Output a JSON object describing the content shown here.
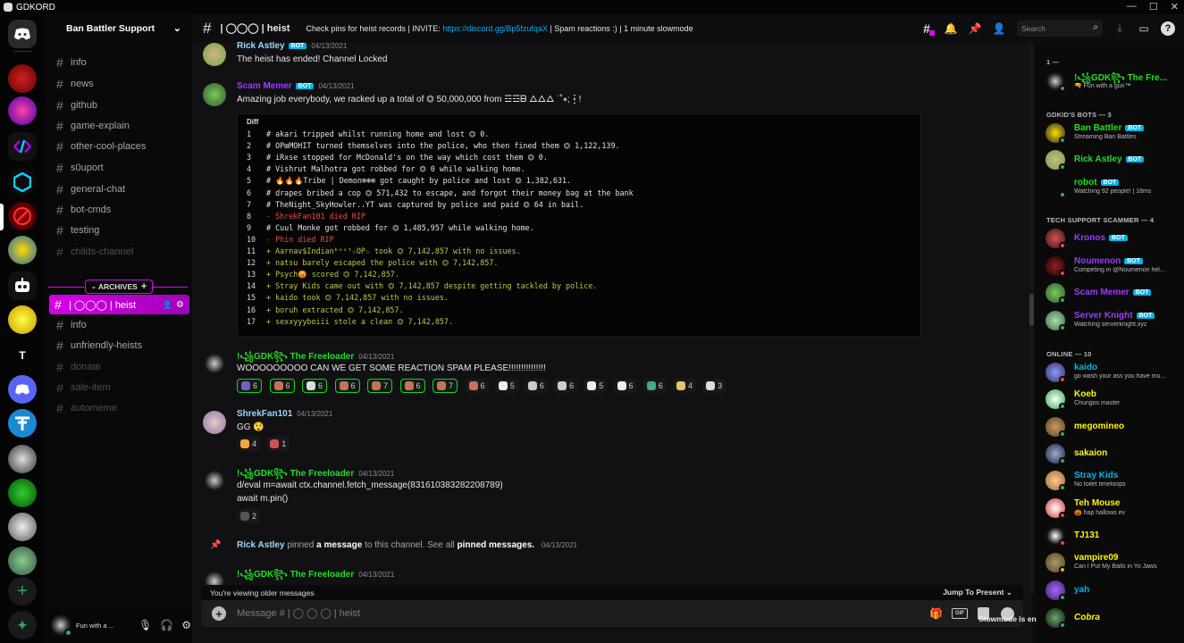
{
  "app_title": "GDKORD",
  "window_controls": [
    "—",
    "☐",
    "✕"
  ],
  "server": {
    "name": "Ban Battler Support"
  },
  "guild_letter": "T",
  "channels": [
    {
      "name": "info",
      "dim": false
    },
    {
      "name": "news",
      "dim": false
    },
    {
      "name": "github",
      "dim": false
    },
    {
      "name": "game-explain",
      "dim": false
    },
    {
      "name": "other-cool-places",
      "dim": false
    },
    {
      "name": "s0uport",
      "dim": false
    },
    {
      "name": "general-chat",
      "dim": false
    },
    {
      "name": "bot-cmds",
      "dim": false
    },
    {
      "name": "testing",
      "dim": false
    },
    {
      "name": "childs-channel",
      "dim": true
    }
  ],
  "archives_label": "ARCHIVES",
  "active_channel": "| ◯◯◯ | heist",
  "archive_channels": [
    {
      "name": "info",
      "dim": false
    },
    {
      "name": "unfriendly-heists",
      "dim": false
    },
    {
      "name": "donate",
      "dim": true
    },
    {
      "name": "sale-item",
      "dim": true
    },
    {
      "name": "automeme",
      "dim": true
    }
  ],
  "user_status": "Fun with a ...",
  "header": {
    "channel_name": "| ◯◯◯ | heist",
    "topic_prefix": "Check pins for heist records | INVITE:",
    "topic_link": "https://discord.gg/Bp5fzufqaX",
    "topic_suffix": "| Spam reactions :) | 1 minute slowmode",
    "search_placeholder": "Search"
  },
  "messages": {
    "m1": {
      "author": "Rick Astley",
      "bot_tag": "BOT",
      "ts": "04/13/2021",
      "text": "The heist has ended! Channel Locked"
    },
    "m2": {
      "author": "Scam Memer",
      "bot_tag": "BOT",
      "ts": "04/13/2021",
      "text": "Amazing job everybody, we racked up a total of ⏣ 50,000,000  from  ☲☲ᗷ ᐃᐃᐃ ˙˚∗;┇!"
    },
    "m3": {
      "author": "!꧁GDK꧂ The Freeloader",
      "ts": "04/13/2021",
      "text": "WOOOOOOOOO CAN WE GET SOME REACTION SPAM PLEASE!!!!!!!!!!!!!!!"
    },
    "m4": {
      "author": "ShrekFan101",
      "ts": "04/13/2021",
      "text": "GG 😲"
    },
    "m5": {
      "author": "!꧁GDK꧂ The Freeloader",
      "ts": "04/13/2021",
      "line1": "d/eval m=await ctx.channel.fetch_message(831610383282208789)",
      "line2": "await m.pin()"
    },
    "m6": {
      "author": "!꧁GDK꧂ The Freeloader",
      "ts": "04/13/2021"
    }
  },
  "pin_notice": {
    "who": "Rick Astley",
    "pinned": "pinned",
    "a_message": "a message",
    "middle": "to this channel. See all",
    "pinned_messages": "pinned messages.",
    "ts": "04/13/2021"
  },
  "diff": {
    "label": "Diff",
    "lines": [
      {
        "n": "1",
        "t": "# akari tripped whilst running home and lost ⏣ 0.",
        "k": "n"
      },
      {
        "n": "2",
        "t": "# OP⊞MOHIT turned themselves into the police, who then fined them ⏣ 1,122,139.",
        "k": "n"
      },
      {
        "n": "3",
        "t": "# iRxse stopped for McDonald's on the way which cost them ⏣ 0.",
        "k": "n"
      },
      {
        "n": "4",
        "t": "# Vishrut Malhotra got robbed for ⏣ 0 while walking home.",
        "k": "n"
      },
      {
        "n": "5",
        "t": "# 🔥🔥🔥Tribe | Demon❄❄❄ got caught by police and lost ⏣ 1,382,631.",
        "k": "n"
      },
      {
        "n": "6",
        "t": "# drapes bribed a cop ⏣ 571,432 to escape, and forgot their money bag at the bank",
        "k": "n"
      },
      {
        "n": "7",
        "t": "# TheNight_SkyHowler..YT was captured by police and paid ⏣ 64 in bail.",
        "k": "n"
      },
      {
        "n": "8",
        "t": "- ShrekFan101 died RIP",
        "k": "m"
      },
      {
        "n": "9",
        "t": "# Cuul Monke got robbed for ⏣ 1,485,957 while walking home.",
        "k": "n"
      },
      {
        "n": "10",
        "t": "- Phin died RIP",
        "k": "m"
      },
      {
        "n": "11",
        "t": "+ Aarnav$Indianᵇᵉˢᵗ☆OP☆ took ⏣ 7,142,857 with no issues.",
        "k": "p"
      },
      {
        "n": "12",
        "t": "+ natsu barely escaped the police with ⏣ 7,142,857.",
        "k": "p"
      },
      {
        "n": "13",
        "t": "+ Psych😡 scored ⏣ 7,142,857.",
        "k": "p"
      },
      {
        "n": "14",
        "t": "+ Stray Kids came out with ⏣ 7,142,857 despite getting tackled by police.",
        "k": "p"
      },
      {
        "n": "15",
        "t": "+ kaido took ⏣ 7,142,857 with no issues.",
        "k": "p"
      },
      {
        "n": "16",
        "t": "+ boruh extracted ⏣ 7,142,857.",
        "k": "p"
      },
      {
        "n": "17",
        "t": "+ sexxyyyboiii stole a clean ⏣ 7,142,857.",
        "k": "p"
      }
    ]
  },
  "reactions_m3": [
    "6",
    "6",
    "6",
    "6",
    "7",
    "6",
    "7",
    "6",
    "5",
    "6",
    "6",
    "5",
    "6",
    "6",
    "4",
    "3"
  ],
  "reactions_m4": [
    "4",
    "1"
  ],
  "reactions_m5": [
    "2"
  ],
  "older_text": "You're viewing older messages",
  "jump_text": "Jump To Present ⌄",
  "composer_placeholder": "Message # | ◯ ◯ ◯ | heist",
  "slowmode_text": "Slowmode is enabled, but you are immune. Amazing! ⏱",
  "members": {
    "top_group": "1 —",
    "top": {
      "name": "!꧁GDK꧂ The Fre...",
      "activity": "🔫 Fun with a gun™"
    },
    "groups": [
      {
        "title": "GDKID'S BOTS — 3"
      },
      {
        "title": "TECH SUPPORT SCAMMER — 4"
      },
      {
        "title": "ONLINE — 10"
      }
    ],
    "bots": [
      {
        "name": "Ban Battler",
        "activity": "Streaming Ban Battles"
      },
      {
        "name": "Rick Astley",
        "activity": ""
      },
      {
        "name": "robot",
        "activity": "Watching 92 people! | 18ms"
      }
    ],
    "scammers": [
      {
        "name": "Kronos",
        "activity": ""
      },
      {
        "name": "Noumenon",
        "activity": "Competing in @Noumenon hel..."
      },
      {
        "name": "Scam Memer",
        "activity": ""
      },
      {
        "name": "Server Knight",
        "activity": "Watching serverknight.xyz"
      }
    ],
    "online": [
      {
        "name": "kaido",
        "activity": "go wash your ass you have mu..."
      },
      {
        "name": "Koeb",
        "activity": "Chungos master"
      },
      {
        "name": "megomineo",
        "activity": ""
      },
      {
        "name": "sakaion",
        "activity": ""
      },
      {
        "name": "Stray Kids",
        "activity": "No toilet timeloops"
      },
      {
        "name": "Teh Mouse",
        "activity": "🎃 hap hallows ev"
      },
      {
        "name": "TJ131",
        "activity": ""
      },
      {
        "name": "vampire09",
        "activity": "Can I Put My Balls in Yo Jaws"
      },
      {
        "name": "yah",
        "activity": ""
      },
      {
        "name": "Cobra",
        "activity": ""
      }
    ],
    "bot_tag": "BOT"
  },
  "colors": {
    "accent": "#e600ff",
    "bot_tag": "#00b4e6",
    "online": "#3ba55d",
    "dnd": "#ed4245",
    "idle": "#faa81a",
    "green_name": "#1fe021",
    "purple_name": "#9b3bff",
    "blue_name": "#00b4e6",
    "yellow_name": "#fff700"
  }
}
